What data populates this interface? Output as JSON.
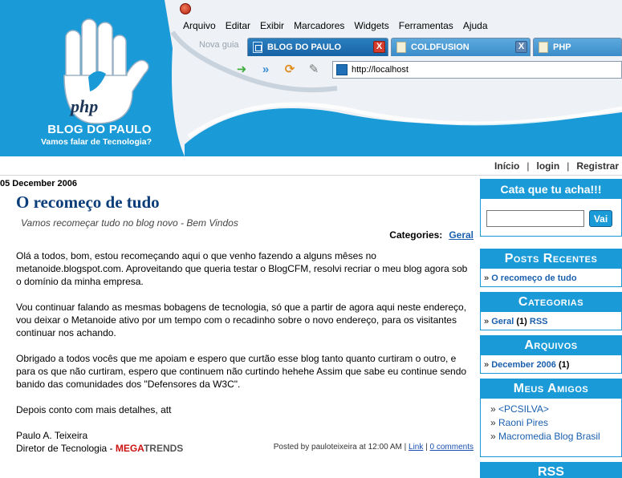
{
  "browser": {
    "menu": [
      "Arquivo",
      "Editar",
      "Exibir",
      "Marcadores",
      "Widgets",
      "Ferramentas",
      "Ajuda"
    ],
    "new_tab_label": "Nova guia",
    "tabs": [
      {
        "label": "BLOG DO PAULO",
        "state": "active",
        "close": "X"
      },
      {
        "label": "COLDFUSION",
        "state": "inactive",
        "close": "X"
      },
      {
        "label": "PHP",
        "state": "inactive"
      }
    ],
    "address": "http://localhost"
  },
  "header": {
    "logo_text": "php",
    "title": "BLOG DO PAULO",
    "subtitle": "Vamos falar de Tecnologia?"
  },
  "top_links": [
    "Início",
    "login",
    "Registrar"
  ],
  "post": {
    "date": "05 December 2006",
    "title": "O recomeço de tudo",
    "subtitle": "Vamos recomeçar tudo no blog novo - Bem Vindos",
    "categories_label": "Categories:",
    "category": "Geral",
    "paragraphs": [
      "Olá a todos, bom, estou recomeçando aqui o que venho fazendo a alguns mêses no metanoide.blogspot.com. Aproveitando que queria testar o BlogCFM, resolvi recriar o meu blog agora sob o domínio da minha empresa.",
      "Vou continuar falando as mesmas bobagens de tecnologia, só que a partir de agora aqui neste endereço, vou deixar o Metanoide ativo por um tempo com o recadinho sobre o novo endereço, para os visitantes continuar nos achando.",
      "Obrigado a todos vocês que me apoiam e espero que curtão esse blog tanto quanto curtiram o outro, e para os que não curtiram, espero que continuem não curtindo hehehe Assim que sabe eu continue sendo banido das comunidades dos \"Defensores da W3C\".",
      "Depois conto com mais detalhes, att"
    ],
    "signature_name": "Paulo A. Teixeira",
    "signature_role": "Diretor de Tecnologia - ",
    "company_part1": "MEGA",
    "company_part2": "TRENDS",
    "footer_posted": "Posted by pauloteixeira at 12:00 AM | ",
    "footer_link": "Link",
    "footer_sep": " | ",
    "footer_comments": "0 comments"
  },
  "sidebar": {
    "search_title": "Cata que tu acha!!!",
    "search_button": "Vai",
    "search_value": "",
    "recent_title": "Posts Recentes",
    "recent_items": [
      "O recomeço de tudo"
    ],
    "categories_title": "Categorias",
    "category_name": "Geral",
    "category_count": "(1)",
    "category_rss": "RSS",
    "archives_title": "Arquivos",
    "archive_name": "December 2006",
    "archive_count": "(1)",
    "friends_title": "Meus Amigos",
    "friends": [
      "<PCSILVA>",
      "Raoni Pires",
      "Macromedia Blog Brasil"
    ],
    "rss_title": "RSS"
  },
  "colors": {
    "brand_blue": "#1a9ad6",
    "title_blue": "#0b3d7a",
    "link_blue": "#1a5fae",
    "mega_red": "#cc1111"
  }
}
